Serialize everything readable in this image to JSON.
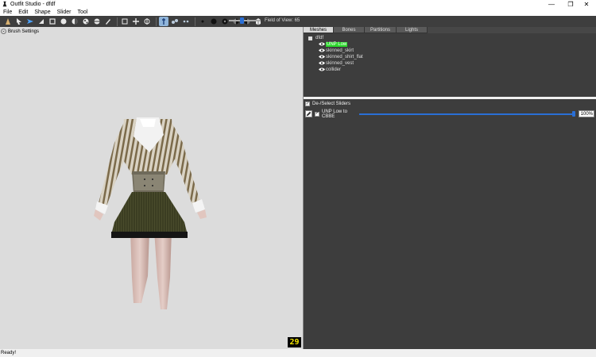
{
  "window": {
    "title": "Outfit Studio - dfdf",
    "minimize_glyph": "—",
    "maximize_glyph": "❐",
    "close_glyph": "✕"
  },
  "menu": [
    "File",
    "Edit",
    "Shape",
    "Slider",
    "Tool"
  ],
  "toolbar": {
    "fov_label": "Field of View: 65",
    "field_of_view": 65,
    "icons": [
      "brush-icon",
      "select-icon",
      "move-icon",
      "inflate-icon",
      "deflate-icon",
      "smooth-icon",
      "undiff-icon",
      "mask-icon",
      "unmask-icon",
      "weight-icon",
      "color-icon",
      "transform-icon",
      "pivot-icon",
      "vertex-select-icon",
      "show-verts-icon",
      "wireframe-icon",
      "lighting-icon",
      "view-front-icon",
      "view-back-icon",
      "view-left-icon",
      "view-right-icon",
      "perspective-icon"
    ]
  },
  "left": {
    "brush_settings": "Brush Settings",
    "fps": "29"
  },
  "tabs": [
    "Meshes",
    "Bones",
    "Partitions",
    "Lights"
  ],
  "tree": {
    "root": "dfdf",
    "items": [
      "UNP Low",
      "skinned_skirt",
      "skinned_shirt_flat",
      "skinned_vest",
      "collider"
    ],
    "selected_index": 0
  },
  "sliders": {
    "deselect_label": "De-/Select Sliders",
    "check_glyph": "✓",
    "rows": [
      {
        "name": "UNP Low to CBBE",
        "value_text": "100%",
        "value": 100
      }
    ]
  },
  "status": "Ready!",
  "colors": {
    "accent": "#2a6fd6",
    "selected_mesh": "#2bd92b",
    "fps": "#f2e400"
  }
}
